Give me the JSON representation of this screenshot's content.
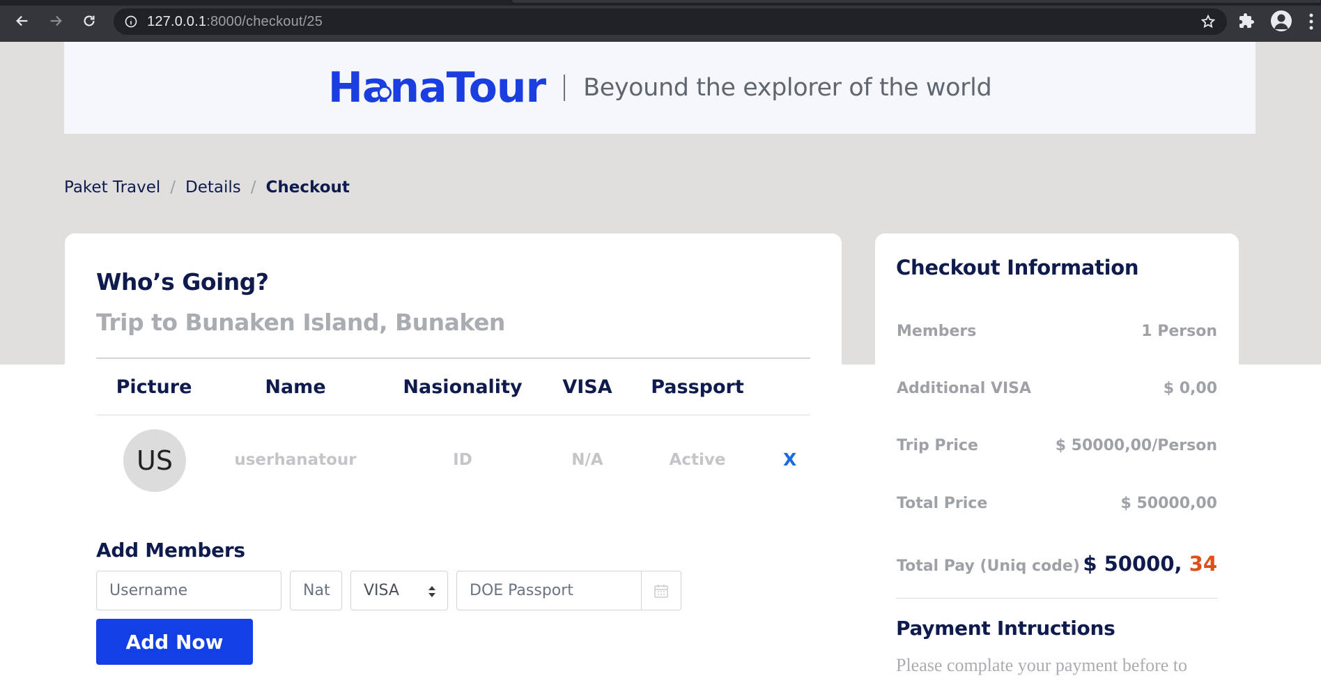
{
  "browser": {
    "url_host": "127.0.0.1",
    "url_rest": ":8000/checkout/25"
  },
  "header": {
    "logo_text": "HanaTour",
    "tagline": "Beyound the explorer of the world"
  },
  "breadcrumb": {
    "items": [
      "Paket Travel",
      "Details",
      "Checkout"
    ],
    "separator": "/"
  },
  "members_card": {
    "title": "Who’s Going?",
    "subtitle": "Trip to Bunaken Island, Bunaken",
    "columns": [
      "Picture",
      "Name",
      "Nasionality",
      "VISA",
      "Passport"
    ],
    "rows": [
      {
        "avatar_initials": "US",
        "name": "userhanatour",
        "nationality": "ID",
        "visa": "N/A",
        "passport": "Active",
        "remove_label": "X"
      }
    ],
    "add_members": {
      "title": "Add Members",
      "username_placeholder": "Username",
      "nat_placeholder": "Nat",
      "visa_selected": "VISA",
      "doe_placeholder": "DOE Passport",
      "button_label": "Add Now"
    }
  },
  "checkout_card": {
    "title": "Checkout Information",
    "rows": [
      {
        "label": "Members",
        "value": "1 Person"
      },
      {
        "label": "Additional VISA",
        "value": "$ 0,00"
      },
      {
        "label": "Trip Price",
        "value": "$ 50000,00/Person"
      },
      {
        "label": "Total Price",
        "value": "$ 50000,00"
      }
    ],
    "total_pay": {
      "label": "Total Pay (Uniq code)",
      "value_main": "$ 50000,",
      "value_code": "34"
    },
    "payment_title": "Payment Intructions",
    "payment_text": "Please complate your payment before to"
  },
  "colors": {
    "brand_blue": "#1a3ee0",
    "navy": "#0f1b4c",
    "accent_orange": "#e04f1a",
    "button_blue": "#1240e6"
  }
}
